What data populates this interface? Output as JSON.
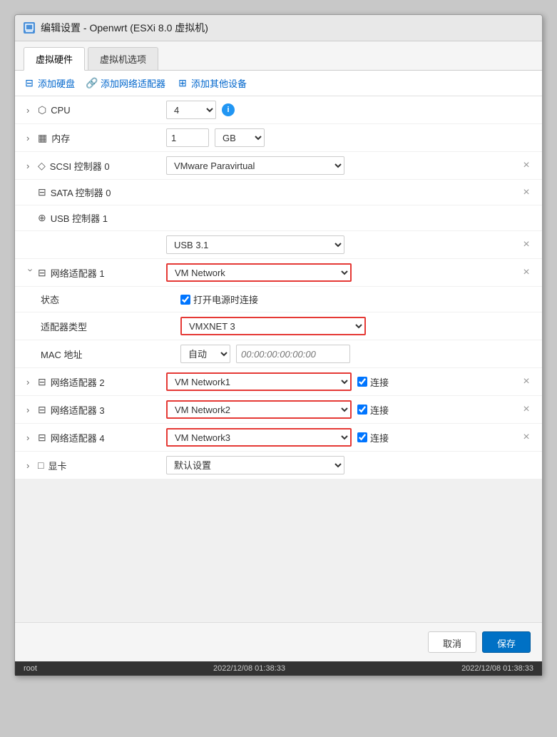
{
  "window": {
    "title": "编辑设置 - Openwrt (ESXi 8.0 虚拟机)",
    "icon": "🖥"
  },
  "tabs": [
    {
      "label": "虚拟硬件",
      "active": true
    },
    {
      "label": "虚拟机选项",
      "active": false
    }
  ],
  "toolbar": {
    "add_disk": "添加硬盘",
    "add_network": "添加网络适配器",
    "add_device": "添加其他设备"
  },
  "rows": {
    "cpu_label": "CPU",
    "cpu_value": "4",
    "memory_label": "内存",
    "memory_value": "1",
    "memory_unit": "GB",
    "scsi_label": "SCSI 控制器 0",
    "scsi_value": "VMware Paravirtual",
    "sata_label": "SATA 控制器 0",
    "usb_label": "USB 控制器 1",
    "usb_value": "USB 3.1",
    "net_adapter1_label": "网络适配器 1",
    "net_adapter1_value": "VM Network",
    "net_status_label": "状态",
    "net_status_checkbox_label": "打开电源时连接",
    "net_adapter_type_label": "适配器类型",
    "net_adapter_type_value": "VMXNET 3",
    "mac_label": "MAC 地址",
    "mac_auto": "自动",
    "mac_placeholder": "00:00:00:00:00:00",
    "net_adapter2_label": "网络适配器 2",
    "net_adapter2_value": "VM Network1",
    "net_adapter2_connect": "连接",
    "net_adapter3_label": "网络适配器 3",
    "net_adapter3_value": "VM Network2",
    "net_adapter3_connect": "连接",
    "net_adapter4_label": "网络适配器 4",
    "net_adapter4_value": "VM Network3",
    "net_adapter4_connect": "连接",
    "display_label": "显卡",
    "display_value": "默认设置"
  },
  "footer": {
    "cancel": "取消",
    "save": "保存"
  },
  "status_bar": {
    "left": "root",
    "center": "2022/12/08 01:38:33",
    "right": "2022/12/08 01:38:33"
  }
}
